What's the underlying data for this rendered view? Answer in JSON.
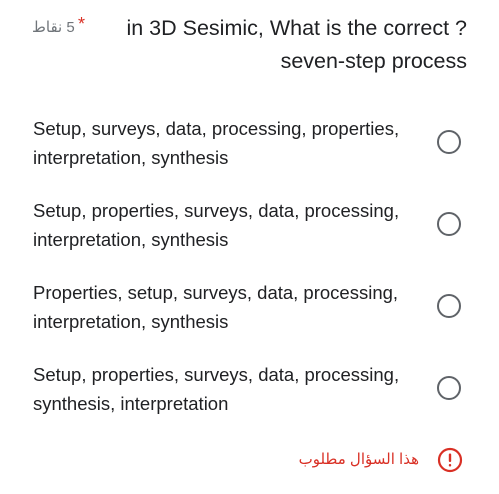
{
  "question": {
    "title": "in 3D Sesimic, What is the correct ?seven-step process",
    "points": "5 نقاط",
    "required_marker": "*"
  },
  "options": [
    {
      "label": "Setup, surveys, data, processing, properties, interpretation, synthesis",
      "selected": false
    },
    {
      "label": "Setup, properties, surveys, data, processing, interpretation, synthesis",
      "selected": false
    },
    {
      "label": "Properties, setup, surveys, data, processing, interpretation, synthesis",
      "selected": false
    },
    {
      "label": "Setup, properties, surveys, data, processing, synthesis, interpretation",
      "selected": false
    }
  ],
  "validation": {
    "message": "هذا السؤال مطلوب",
    "icon": "error-icon",
    "color": "#d93025"
  },
  "colors": {
    "radio_border": "#5f6368",
    "text": "#202124",
    "secondary_text": "#70757a"
  }
}
